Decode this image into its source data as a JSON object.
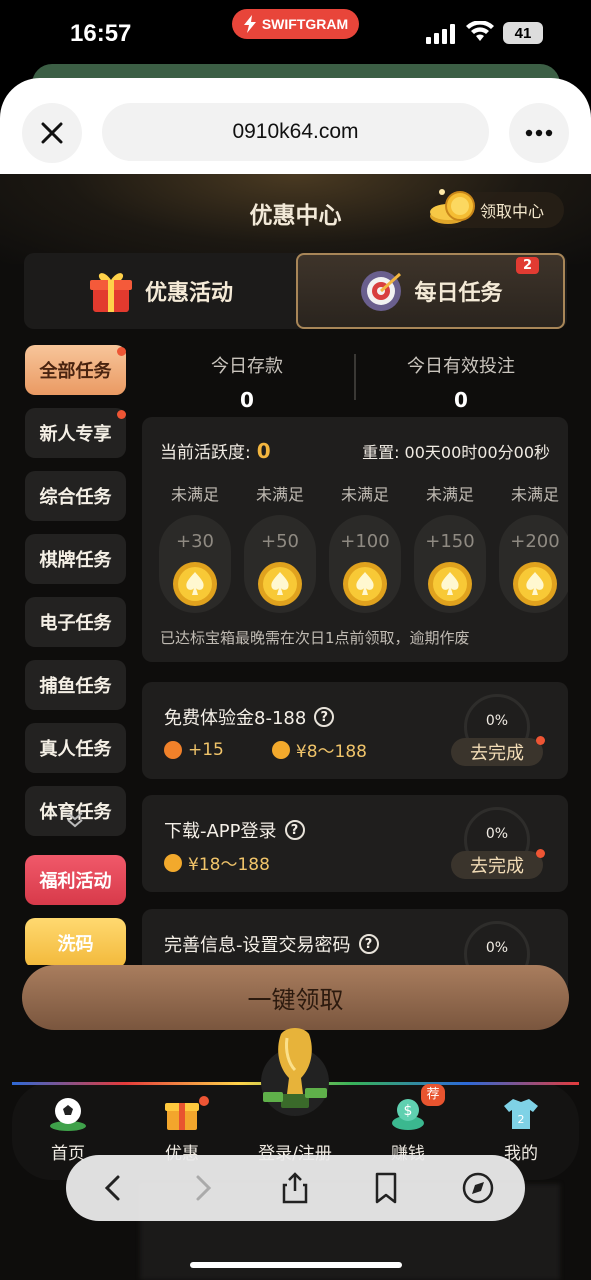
{
  "status_bar": {
    "time": "16:57",
    "app_badge": "SWIFTGRAM",
    "battery": "41"
  },
  "browser": {
    "url": "0910k64.com"
  },
  "header": {
    "title": "优惠中心",
    "claim_center": "领取中心"
  },
  "tabs": [
    {
      "label": "优惠活动"
    },
    {
      "label": "每日任务",
      "badge": "2"
    }
  ],
  "sidebar": {
    "items": [
      {
        "label": "全部任务"
      },
      {
        "label": "新人专享"
      },
      {
        "label": "综合任务"
      },
      {
        "label": "棋牌任务"
      },
      {
        "label": "电子任务"
      },
      {
        "label": "捕鱼任务"
      },
      {
        "label": "真人任务"
      },
      {
        "label": "体育任务"
      },
      {
        "label": "福利活动"
      },
      {
        "label": "洗码"
      }
    ]
  },
  "stats": {
    "deposit_label": "今日存款",
    "deposit_value": "0",
    "bet_label": "今日有效投注",
    "bet_value": "0"
  },
  "activity": {
    "label": "当前活跃度:",
    "value": "0",
    "reset": "重置: 00天00时00分00秒",
    "steps": [
      {
        "status": "未满足",
        "points": "+30"
      },
      {
        "status": "未满足",
        "points": "+50"
      },
      {
        "status": "未满足",
        "points": "+100"
      },
      {
        "status": "未满足",
        "points": "+150"
      },
      {
        "status": "未满足",
        "points": "+200"
      }
    ],
    "note": "已达标宝箱最晚需在次日1点前领取，逾期作废"
  },
  "tasks": [
    {
      "title": "免费体验金8-188",
      "reward1": "+15",
      "reward2": "¥8～188",
      "progress": "0%",
      "button": "去完成"
    },
    {
      "title": "下载-APP登录",
      "reward1": "¥18～188",
      "progress": "0%",
      "button": "去完成"
    },
    {
      "title": "完善信息-设置交易密码",
      "progress": "0%"
    }
  ],
  "claim_all": "一键领取",
  "bottom_nav": [
    {
      "label": "首页"
    },
    {
      "label": "优惠"
    },
    {
      "label": "登录/注册"
    },
    {
      "label": "赚钱",
      "badge": "荐"
    },
    {
      "label": "我的"
    }
  ],
  "colors": {
    "accent_gold": "#f3b63f",
    "badge_red": "#e13b32",
    "sidebar_active": "#ea9a63"
  }
}
